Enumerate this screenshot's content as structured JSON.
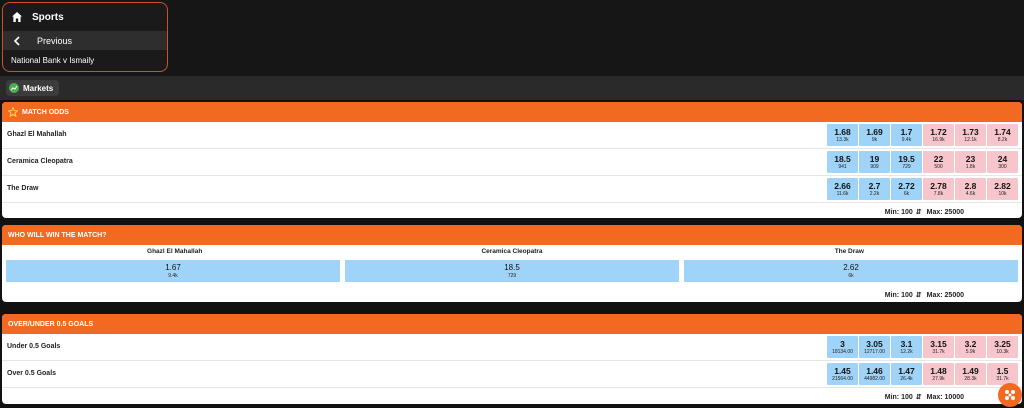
{
  "nav": {
    "sports_label": "Sports",
    "previous_label": "Previous",
    "event_label": "National Bank v Ismaily"
  },
  "tabs": {
    "markets_label": "Markets"
  },
  "colors": {
    "accent": "#f26a21",
    "back": "#9fd3f7",
    "lay": "#f7c6cc"
  },
  "match_odds": {
    "title": "MATCH ODDS",
    "rows": [
      {
        "label": "Ghazl El Mahallah",
        "cells": [
          {
            "p": "1.68",
            "s": "13.3k"
          },
          {
            "p": "1.69",
            "s": "9k"
          },
          {
            "p": "1.7",
            "s": "9.4k"
          },
          {
            "p": "1.72",
            "s": "16.9k"
          },
          {
            "p": "1.73",
            "s": "12.1k"
          },
          {
            "p": "1.74",
            "s": "8.2k"
          }
        ]
      },
      {
        "label": "Ceramica Cleopatra",
        "cells": [
          {
            "p": "18.5",
            "s": "941"
          },
          {
            "p": "19",
            "s": "909"
          },
          {
            "p": "19.5",
            "s": "729"
          },
          {
            "p": "22",
            "s": "500"
          },
          {
            "p": "23",
            "s": "1.8k"
          },
          {
            "p": "24",
            "s": "300"
          }
        ]
      },
      {
        "label": "The Draw",
        "cells": [
          {
            "p": "2.66",
            "s": "11.6k"
          },
          {
            "p": "2.7",
            "s": "2.2k"
          },
          {
            "p": "2.72",
            "s": "6k"
          },
          {
            "p": "2.78",
            "s": "7.8k"
          },
          {
            "p": "2.8",
            "s": "4.6k"
          },
          {
            "p": "2.82",
            "s": "10k"
          }
        ]
      }
    ],
    "min_label": "Min: 100",
    "max_label": "Max: 25000"
  },
  "who_will_win": {
    "title": "WHO WILL WIN THE MATCH?",
    "columns": [
      {
        "name": "Ghazl El Mahallah",
        "p": "1.67",
        "s": "9.4k"
      },
      {
        "name": "Ceramica Cleopatra",
        "p": "18.5",
        "s": "729"
      },
      {
        "name": "The Draw",
        "p": "2.62",
        "s": "6k"
      }
    ],
    "min_label": "Min: 100",
    "max_label": "Max: 25000"
  },
  "over_under": {
    "title": "OVER/UNDER 0.5 GOALS",
    "rows": [
      {
        "label": "Under 0.5 Goals",
        "cells": [
          {
            "p": "3",
            "s": "18134.00"
          },
          {
            "p": "3.05",
            "s": "12717.00"
          },
          {
            "p": "3.1",
            "s": "12.2k"
          },
          {
            "p": "3.15",
            "s": "31.7k"
          },
          {
            "p": "3.2",
            "s": "5.9k"
          },
          {
            "p": "3.25",
            "s": "10.3k"
          }
        ]
      },
      {
        "label": "Over 0.5 Goals",
        "cells": [
          {
            "p": "1.45",
            "s": "21564.00"
          },
          {
            "p": "1.46",
            "s": "44982.00"
          },
          {
            "p": "1.47",
            "s": "26.4k"
          },
          {
            "p": "1.48",
            "s": "27.9k"
          },
          {
            "p": "1.49",
            "s": "28.3k"
          },
          {
            "p": "1.5",
            "s": "31.7k"
          }
        ]
      }
    ],
    "min_label": "Min: 100",
    "max_label": "Max: 10000"
  }
}
